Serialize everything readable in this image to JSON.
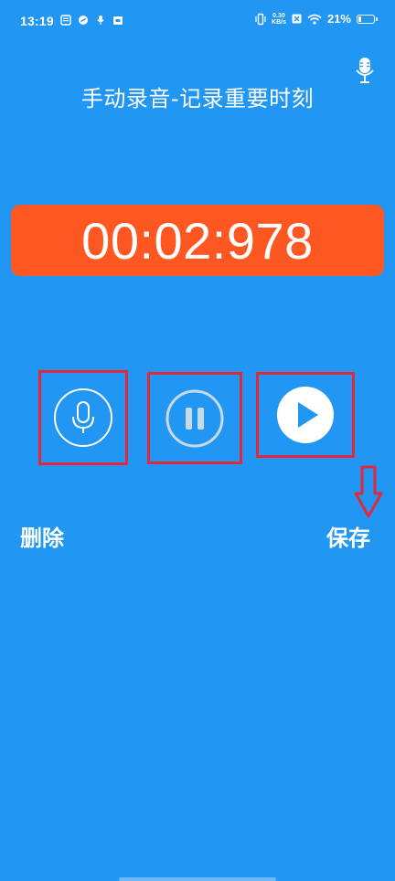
{
  "status_bar": {
    "time": "13:19",
    "net_speed_value": "0.30",
    "net_speed_unit": "KB/s",
    "battery": "21%",
    "battery_level": 0.21
  },
  "header": {
    "title": "手动录音-记录重要时刻",
    "mic_icon": "microphone-icon"
  },
  "timer": {
    "value": "00:02:978",
    "background_color": "#FF5722"
  },
  "controls": {
    "record_icon": "microphone-icon",
    "pause_icon": "pause-icon",
    "play_icon": "play-icon",
    "highlight_color": "#E2283A"
  },
  "actions": {
    "delete_label": "删除",
    "save_label": "保存"
  },
  "theme": {
    "background": "#2196F3"
  }
}
